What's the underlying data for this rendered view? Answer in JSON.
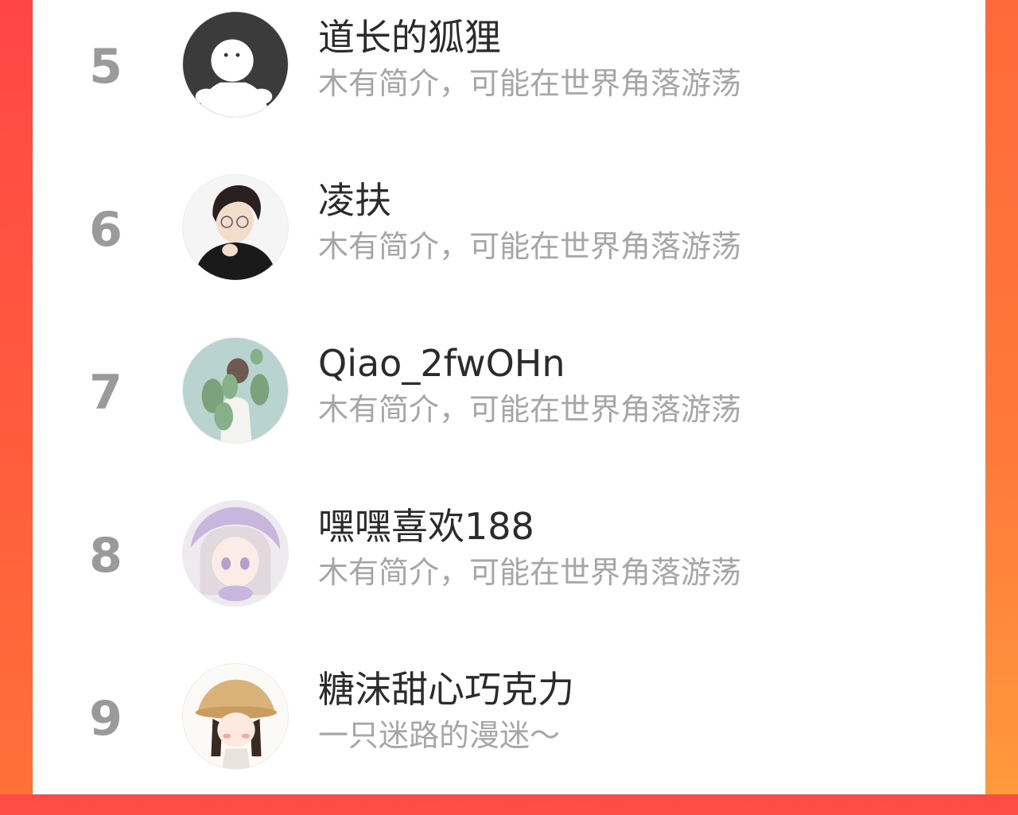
{
  "ranking": {
    "items": [
      {
        "rank": "5",
        "name": "道长的狐狸",
        "bio": "木有简介，可能在世界角落游荡",
        "avatar_icon": "default-ghost-avatar-icon"
      },
      {
        "rank": "6",
        "name": "凌扶",
        "bio": "木有简介，可能在世界角落游荡",
        "avatar_icon": "boy-glasses-avatar-icon"
      },
      {
        "rank": "7",
        "name": "Qiao_2fwOHn",
        "bio": "木有简介，可能在世界角落游荡",
        "avatar_icon": "cactus-girl-avatar-icon"
      },
      {
        "rank": "8",
        "name": "嘿嘿喜欢188",
        "bio": "木有简介，可能在世界角落游荡",
        "avatar_icon": "anime-girl-avatar-icon"
      },
      {
        "rank": "9",
        "name": "糖沫甜心巧克力",
        "bio": "一只迷路的漫迷～",
        "avatar_icon": "hat-girl-avatar-icon"
      }
    ]
  },
  "colors": {
    "rank_gray": "#9a9a9a",
    "name_text": "#2b2b2b",
    "bio_text": "#a6a6a6",
    "side_gradient_top": "#ff4646",
    "side_gradient_bottom": "#ff9a3d"
  }
}
